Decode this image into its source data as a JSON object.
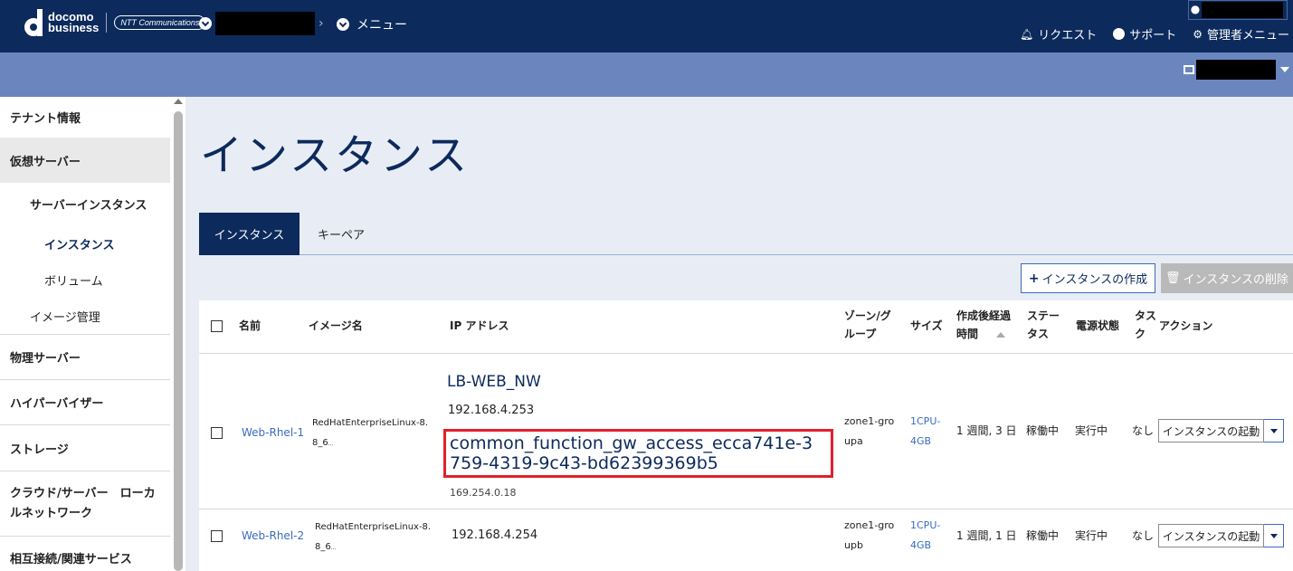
{
  "header": {
    "logo_line1": "docomo",
    "logo_line2": "business",
    "logo_ntt": "NTT Communications",
    "menu_label": "メニュー",
    "request_label": "リクエスト",
    "support_label": "サポート",
    "admin_label": "管理者メニュー"
  },
  "sidebar": {
    "items": [
      {
        "label": "テナント情報"
      },
      {
        "label": "仮想サーバー"
      },
      {
        "label": "サーバーインスタンス"
      },
      {
        "label": "インスタンス"
      },
      {
        "label": "ボリューム"
      },
      {
        "label": "イメージ管理"
      },
      {
        "label": "物理サーバー"
      },
      {
        "label": "ハイパーバイザー"
      },
      {
        "label": "ストレージ"
      },
      {
        "label": "クラウド/サーバー　ローカ"
      },
      {
        "label": "ルネットワーク"
      },
      {
        "label": "相互接続/関連サービス"
      }
    ]
  },
  "main": {
    "title": "インスタンス",
    "tabs": [
      {
        "label": "インスタンス"
      },
      {
        "label": "キーペア"
      }
    ],
    "create_button": "インスタンスの作成",
    "delete_button": "インスタンスの削除"
  },
  "table": {
    "headers": {
      "name": "名前",
      "image": "イメージ名",
      "ip": "IP アドレス",
      "zone_1": "ゾーン/グ",
      "zone_2": "ループ",
      "size": "サイズ",
      "age_1": "作成後経過",
      "age_2": "時間",
      "status_1": "ステー",
      "status_2": "タス",
      "power": "電源状態",
      "task_1": "タス",
      "task_2": "ク",
      "action": "アクション"
    },
    "rows": [
      {
        "name": "Web-Rhel-1",
        "image_1": "RedHatEnterpriseLinux-8.",
        "image_2": "8_6",
        "image_3": "...",
        "network": "LB-WEB_NW",
        "ip1": "192.168.4.253",
        "ip_link_1": "common_function_gw_access_ecca741e-3",
        "ip_link_2": "759-4319-9c43-bd62399369b5",
        "ip2": "169.254.0.18",
        "zone_1": "zone1-gro",
        "zone_2": "upa",
        "size_1": "1CPU-",
        "size_2": "4GB",
        "age": "1 週間, 3 日",
        "status": "稼働中",
        "power": "実行中",
        "task": "なし",
        "action": "インスタンスの起動"
      },
      {
        "name": "Web-Rhel-2",
        "image_1": "RedHatEnterpriseLinux-8.",
        "image_2": "8_6",
        "image_3": "...",
        "ip1": "192.168.4.254",
        "zone_1": "zone1-gro",
        "zone_2": "upb",
        "size_1": "1CPU-",
        "size_2": "4GB",
        "age": "1 週間, 1 日",
        "status": "稼働中",
        "power": "実行中",
        "task": "なし",
        "action": "インスタンスの起動"
      }
    ]
  }
}
